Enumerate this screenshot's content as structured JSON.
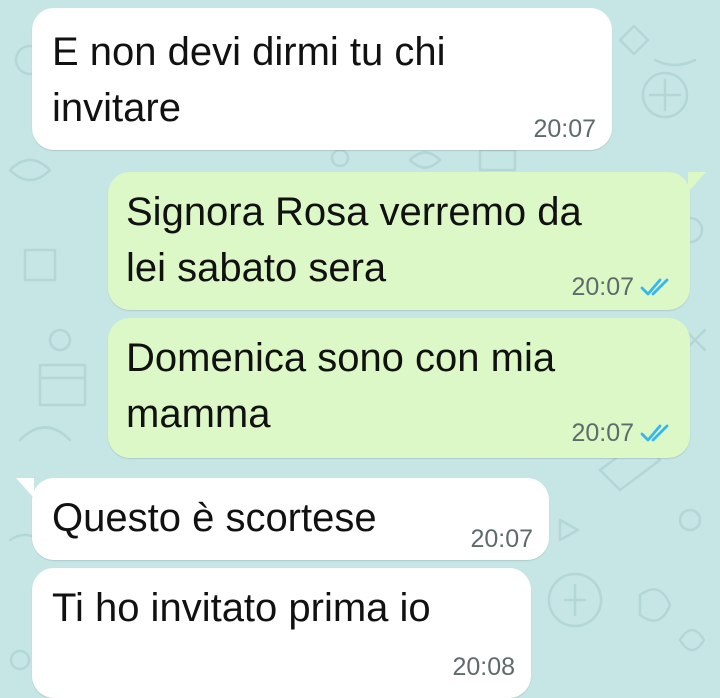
{
  "colors": {
    "background": "#c6e6e6",
    "incoming_bubble": "#ffffff",
    "outgoing_bubble": "#dcf8c6",
    "timestamp": "#5f6b6b",
    "read_ticks": "#34b7f1"
  },
  "messages": [
    {
      "direction": "incoming",
      "lines": [
        "E non devi dirmi tu chi",
        "invitare"
      ],
      "time": "20:07"
    },
    {
      "direction": "outgoing",
      "lines": [
        "Signora Rosa verremo da",
        "lei sabato sera"
      ],
      "time": "20:07",
      "status_icon": "double-check-read-icon"
    },
    {
      "direction": "outgoing",
      "lines": [
        "Domenica sono con mia",
        "mamma"
      ],
      "time": "20:07",
      "status_icon": "double-check-read-icon"
    },
    {
      "direction": "incoming",
      "lines": [
        "Questo è scortese"
      ],
      "time": "20:07"
    },
    {
      "direction": "incoming",
      "lines": [
        "Ti ho invitato prima io"
      ],
      "time": "20:08"
    }
  ]
}
